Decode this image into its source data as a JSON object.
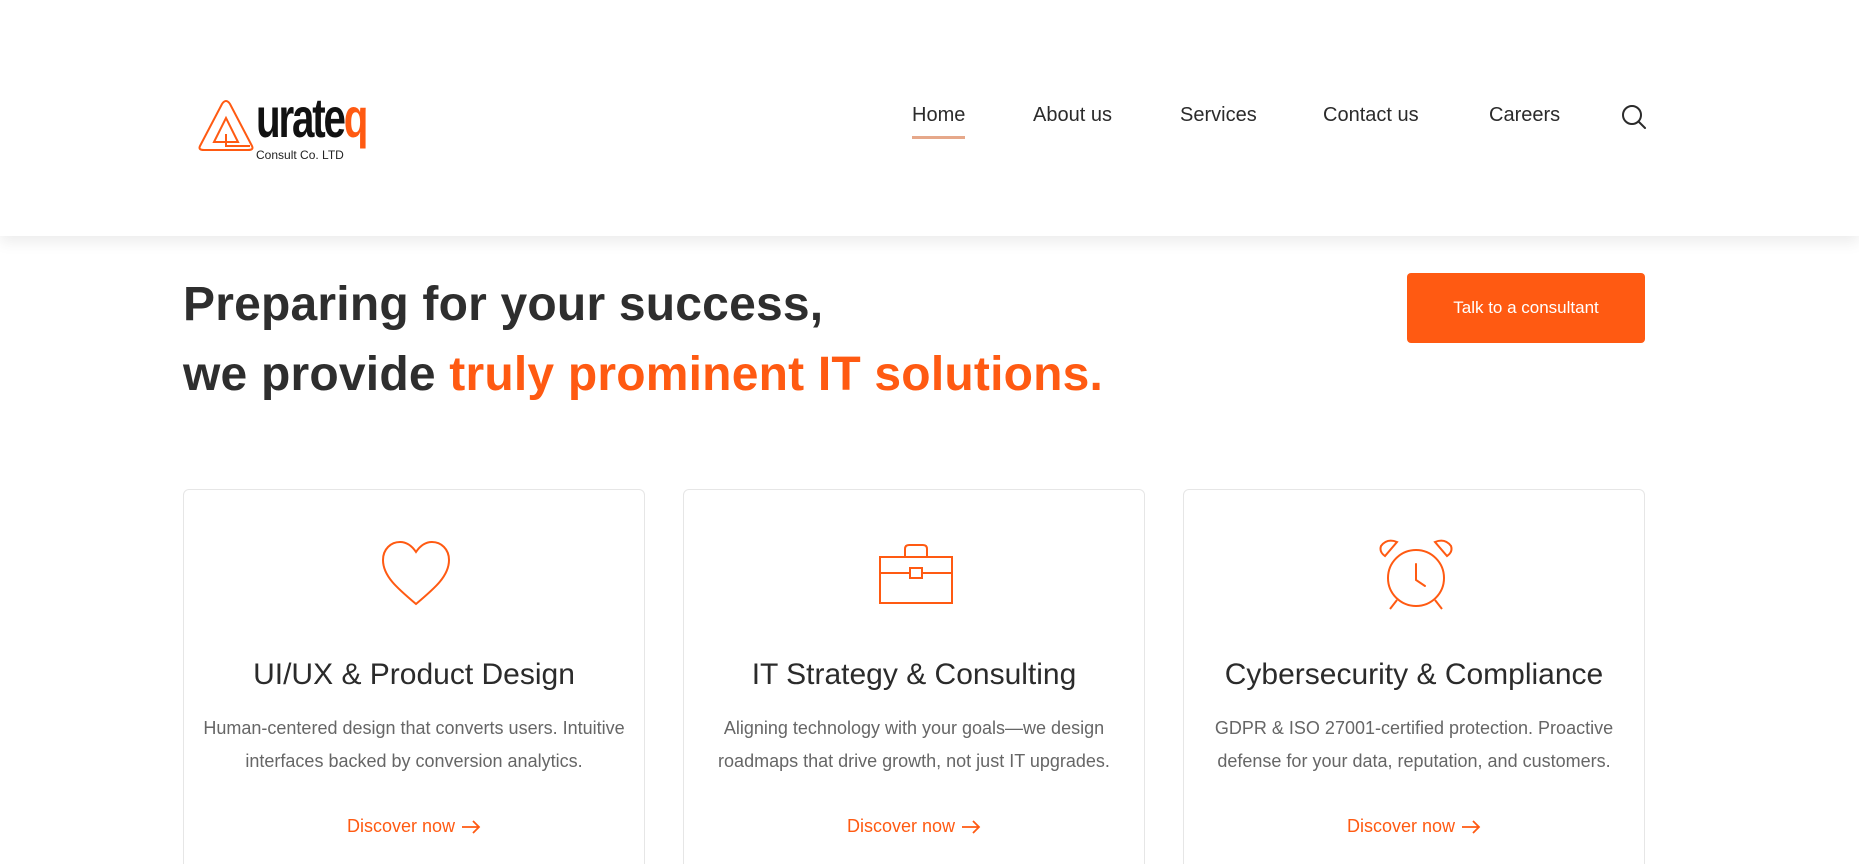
{
  "brand": {
    "logo_text": "urate",
    "logo_q": "q",
    "logo_subtitle": "Consult Co. LTD",
    "accent_color": "#ff5a12"
  },
  "nav": {
    "items": [
      {
        "label": "Home",
        "active": true
      },
      {
        "label": "About us",
        "active": false
      },
      {
        "label": "Services",
        "active": false
      },
      {
        "label": "Contact us",
        "active": false
      },
      {
        "label": "Careers",
        "active": false
      }
    ],
    "search_icon": "search-icon"
  },
  "hero": {
    "line1": "Preparing for your success,",
    "line2_prefix": "we provide ",
    "line2_accent": "truly prominent IT solutions.",
    "cta_label": "Talk to a consultant"
  },
  "cards": [
    {
      "icon": "heart-icon",
      "title": "UI/UX & Product Design",
      "desc_line1": "Human-centered design that converts users. Intuitive",
      "desc_line2": "interfaces backed by conversion analytics.",
      "link": "Discover now"
    },
    {
      "icon": "briefcase-icon",
      "title": "IT Strategy & Consulting",
      "desc_line1": "Aligning technology with your goals—we design",
      "desc_line2": "roadmaps that drive growth, not just IT upgrades.",
      "link": "Discover now"
    },
    {
      "icon": "alarm-clock-icon",
      "title": "Cybersecurity & Compliance",
      "desc_line1": "GDPR & ISO 27001-certified protection. Proactive",
      "desc_line2": "defense for your data, reputation, and customers.",
      "link": "Discover now"
    }
  ]
}
